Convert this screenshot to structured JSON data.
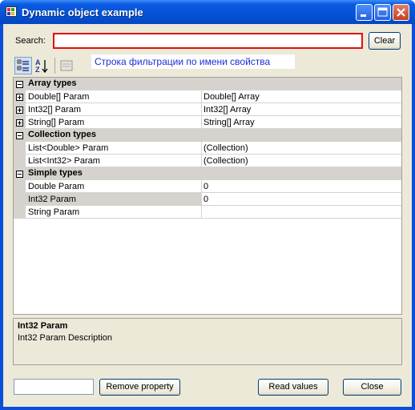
{
  "window": {
    "title": "Dynamic object example"
  },
  "search": {
    "label": "Search:",
    "value": "",
    "placeholder": "",
    "clear_label": "Clear"
  },
  "toolbar": {
    "categorized_icon": "categorized-icon",
    "alphabetical_icon": "sort-az-icon",
    "property_pages_icon": "property-pages-icon",
    "hint": "Строка фильтрации по имени свойства"
  },
  "grid": {
    "categories": [
      {
        "name": "Array types",
        "rows": [
          {
            "name": "Double[] Param",
            "value": "Double[] Array",
            "expandable": true
          },
          {
            "name": "Int32[] Param",
            "value": "Int32[] Array",
            "expandable": true
          },
          {
            "name": "String[] Param",
            "value": "String[] Array",
            "expandable": true
          }
        ]
      },
      {
        "name": "Collection types",
        "rows": [
          {
            "name": "List<Double> Param",
            "value": "(Collection)",
            "expandable": false
          },
          {
            "name": "List<Int32> Param",
            "value": "(Collection)",
            "expandable": false
          }
        ]
      },
      {
        "name": "Simple types",
        "rows": [
          {
            "name": "Double Param",
            "value": "0",
            "expandable": false
          },
          {
            "name": "Int32 Param",
            "value": "0",
            "expandable": false,
            "selected": true
          },
          {
            "name": "String Param",
            "value": "",
            "expandable": false
          }
        ]
      }
    ]
  },
  "description": {
    "title": "Int32 Param",
    "text": "Int32 Param Description"
  },
  "footer": {
    "name_value": "",
    "remove_label": "Remove property",
    "read_label": "Read values",
    "close_label": "Close"
  },
  "colors": {
    "title_bar": "#0453d6",
    "face": "#ece9d8",
    "search_border": "#e01010",
    "hint_text": "#1a2fd6"
  }
}
